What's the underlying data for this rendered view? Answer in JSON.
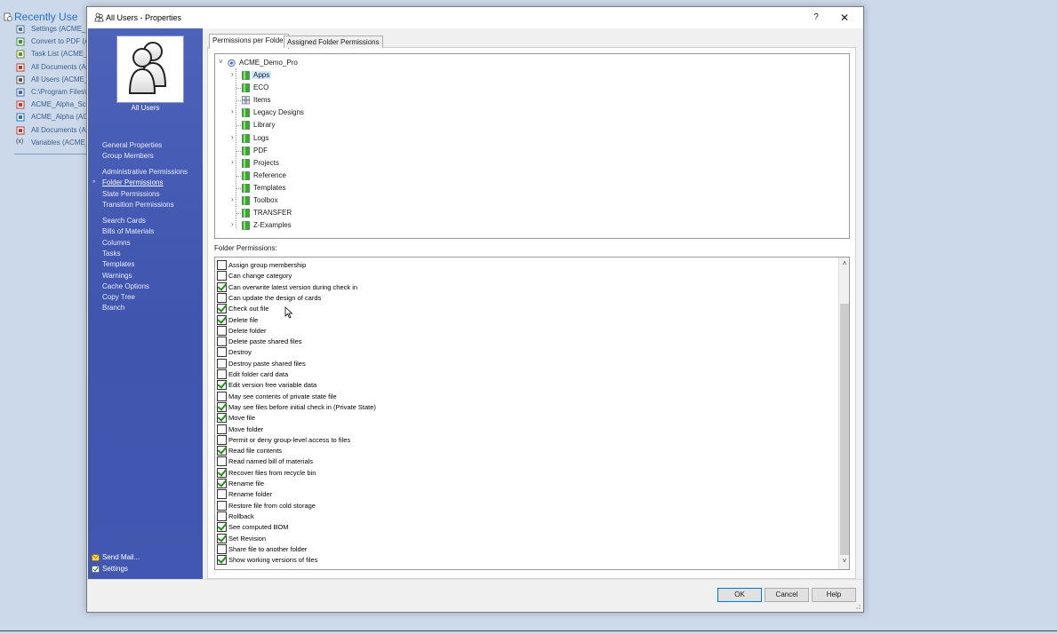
{
  "background": {
    "title": "Recently Use",
    "items": [
      {
        "label": "Settings (ACME_D",
        "icon": "settings-icon"
      },
      {
        "label": "Convert to PDF (A",
        "icon": "pdf-convert-icon"
      },
      {
        "label": "Task List (ACME_",
        "icon": "task-list-icon"
      },
      {
        "label": "All Documents (AC",
        "icon": "documents-tree-icon"
      },
      {
        "label": "All Users (ACME_",
        "icon": "users-icon"
      },
      {
        "label": "C:\\Program Files\\",
        "icon": "folder-gear-icon"
      },
      {
        "label": "ACME_Alpha_Sch",
        "icon": "checkbox-red-icon"
      },
      {
        "label": "ACME_Alpha (AC",
        "icon": "vault-icon"
      },
      {
        "label": "All Documents (AC",
        "icon": "documents-tree-icon"
      },
      {
        "label": "Variables (ACME_",
        "icon": "variables-icon"
      }
    ],
    "variables_glyph": "(x)"
  },
  "dialog": {
    "title": "All Users - Properties",
    "help_glyph": "?",
    "close_glyph": "✕"
  },
  "nav": {
    "caption": "All Users",
    "groups": [
      [
        "General Properties",
        "Group Members"
      ],
      [
        "Administrative Permissions",
        "Folder Permissions",
        "State Permissions",
        "Transition Permissions"
      ],
      [
        "Search Cards",
        "Bills of Materials",
        "Columns",
        "Tasks",
        "Templates",
        "Warnings",
        "Cache Options",
        "Copy Tree",
        "Branch"
      ]
    ],
    "active": "Folder Permissions",
    "active_bullet": "»",
    "footer": [
      "Send Mail...",
      "Settings"
    ]
  },
  "tabs": [
    "Permissions per Folder",
    "Assigned Folder Permissions"
  ],
  "tree": {
    "root": "ACME_Demo_Pro",
    "children": [
      {
        "label": "Apps",
        "expandable": true,
        "selected": true,
        "icon": "folder-icon"
      },
      {
        "label": "ECO",
        "expandable": false,
        "icon": "folder-icon"
      },
      {
        "label": "Items",
        "expandable": false,
        "icon": "items-icon"
      },
      {
        "label": "Legacy Designs",
        "expandable": true,
        "icon": "folder-icon"
      },
      {
        "label": "Library",
        "expandable": false,
        "icon": "folder-icon"
      },
      {
        "label": "Logs",
        "expandable": true,
        "icon": "folder-icon"
      },
      {
        "label": "PDF",
        "expandable": false,
        "icon": "folder-icon"
      },
      {
        "label": "Projects",
        "expandable": true,
        "icon": "folder-icon"
      },
      {
        "label": "Reference",
        "expandable": false,
        "icon": "folder-icon"
      },
      {
        "label": "Templates",
        "expandable": false,
        "icon": "folder-icon"
      },
      {
        "label": "Toolbox",
        "expandable": true,
        "icon": "folder-icon"
      },
      {
        "label": "TRANSFER",
        "expandable": false,
        "icon": "folder-icon"
      },
      {
        "label": "Z-Examples",
        "expandable": true,
        "icon": "folder-icon"
      }
    ]
  },
  "folder_permissions_label": "Folder Permissions:",
  "permissions": [
    {
      "label": "Assign group membership",
      "checked": false
    },
    {
      "label": "Can change category",
      "checked": false
    },
    {
      "label": "Can overwrite latest version during check in",
      "checked": true
    },
    {
      "label": "Can update the design of cards",
      "checked": false
    },
    {
      "label": "Check out file",
      "checked": true
    },
    {
      "label": "Delete file",
      "checked": true
    },
    {
      "label": "Delete folder",
      "checked": false
    },
    {
      "label": "Delete paste shared files",
      "checked": false
    },
    {
      "label": "Destroy",
      "checked": false
    },
    {
      "label": "Destroy paste shared files",
      "checked": false
    },
    {
      "label": "Edit folder card data",
      "checked": false
    },
    {
      "label": "Edit version free variable data",
      "checked": true
    },
    {
      "label": "May see contents of private state file",
      "checked": false
    },
    {
      "label": "May see files before initial check in (Private State)",
      "checked": true
    },
    {
      "label": "Move file",
      "checked": true
    },
    {
      "label": "Move folder",
      "checked": false
    },
    {
      "label": "Permit or deny group-level access to files",
      "checked": false
    },
    {
      "label": "Read file contents",
      "checked": true
    },
    {
      "label": "Read named bill of materials",
      "checked": false
    },
    {
      "label": "Recover files from recycle bin",
      "checked": true
    },
    {
      "label": "Rename file",
      "checked": true
    },
    {
      "label": "Rename folder",
      "checked": false
    },
    {
      "label": "Restore file from cold storage",
      "checked": false
    },
    {
      "label": "Rollback",
      "checked": false
    },
    {
      "label": "See computed BOM",
      "checked": true
    },
    {
      "label": "Set Revision",
      "checked": true
    },
    {
      "label": "Share file to another folder",
      "checked": false
    },
    {
      "label": "Show working versions of files",
      "checked": true
    }
  ],
  "scroll_glyphs": {
    "up": "˄",
    "down": "˅"
  },
  "buttons": {
    "ok": "OK",
    "cancel": "Cancel",
    "help": "Help"
  },
  "colors": {
    "nav_blue": "#4258b2",
    "check_green": "#2b8a1f",
    "folder_green": "#3aa832"
  }
}
